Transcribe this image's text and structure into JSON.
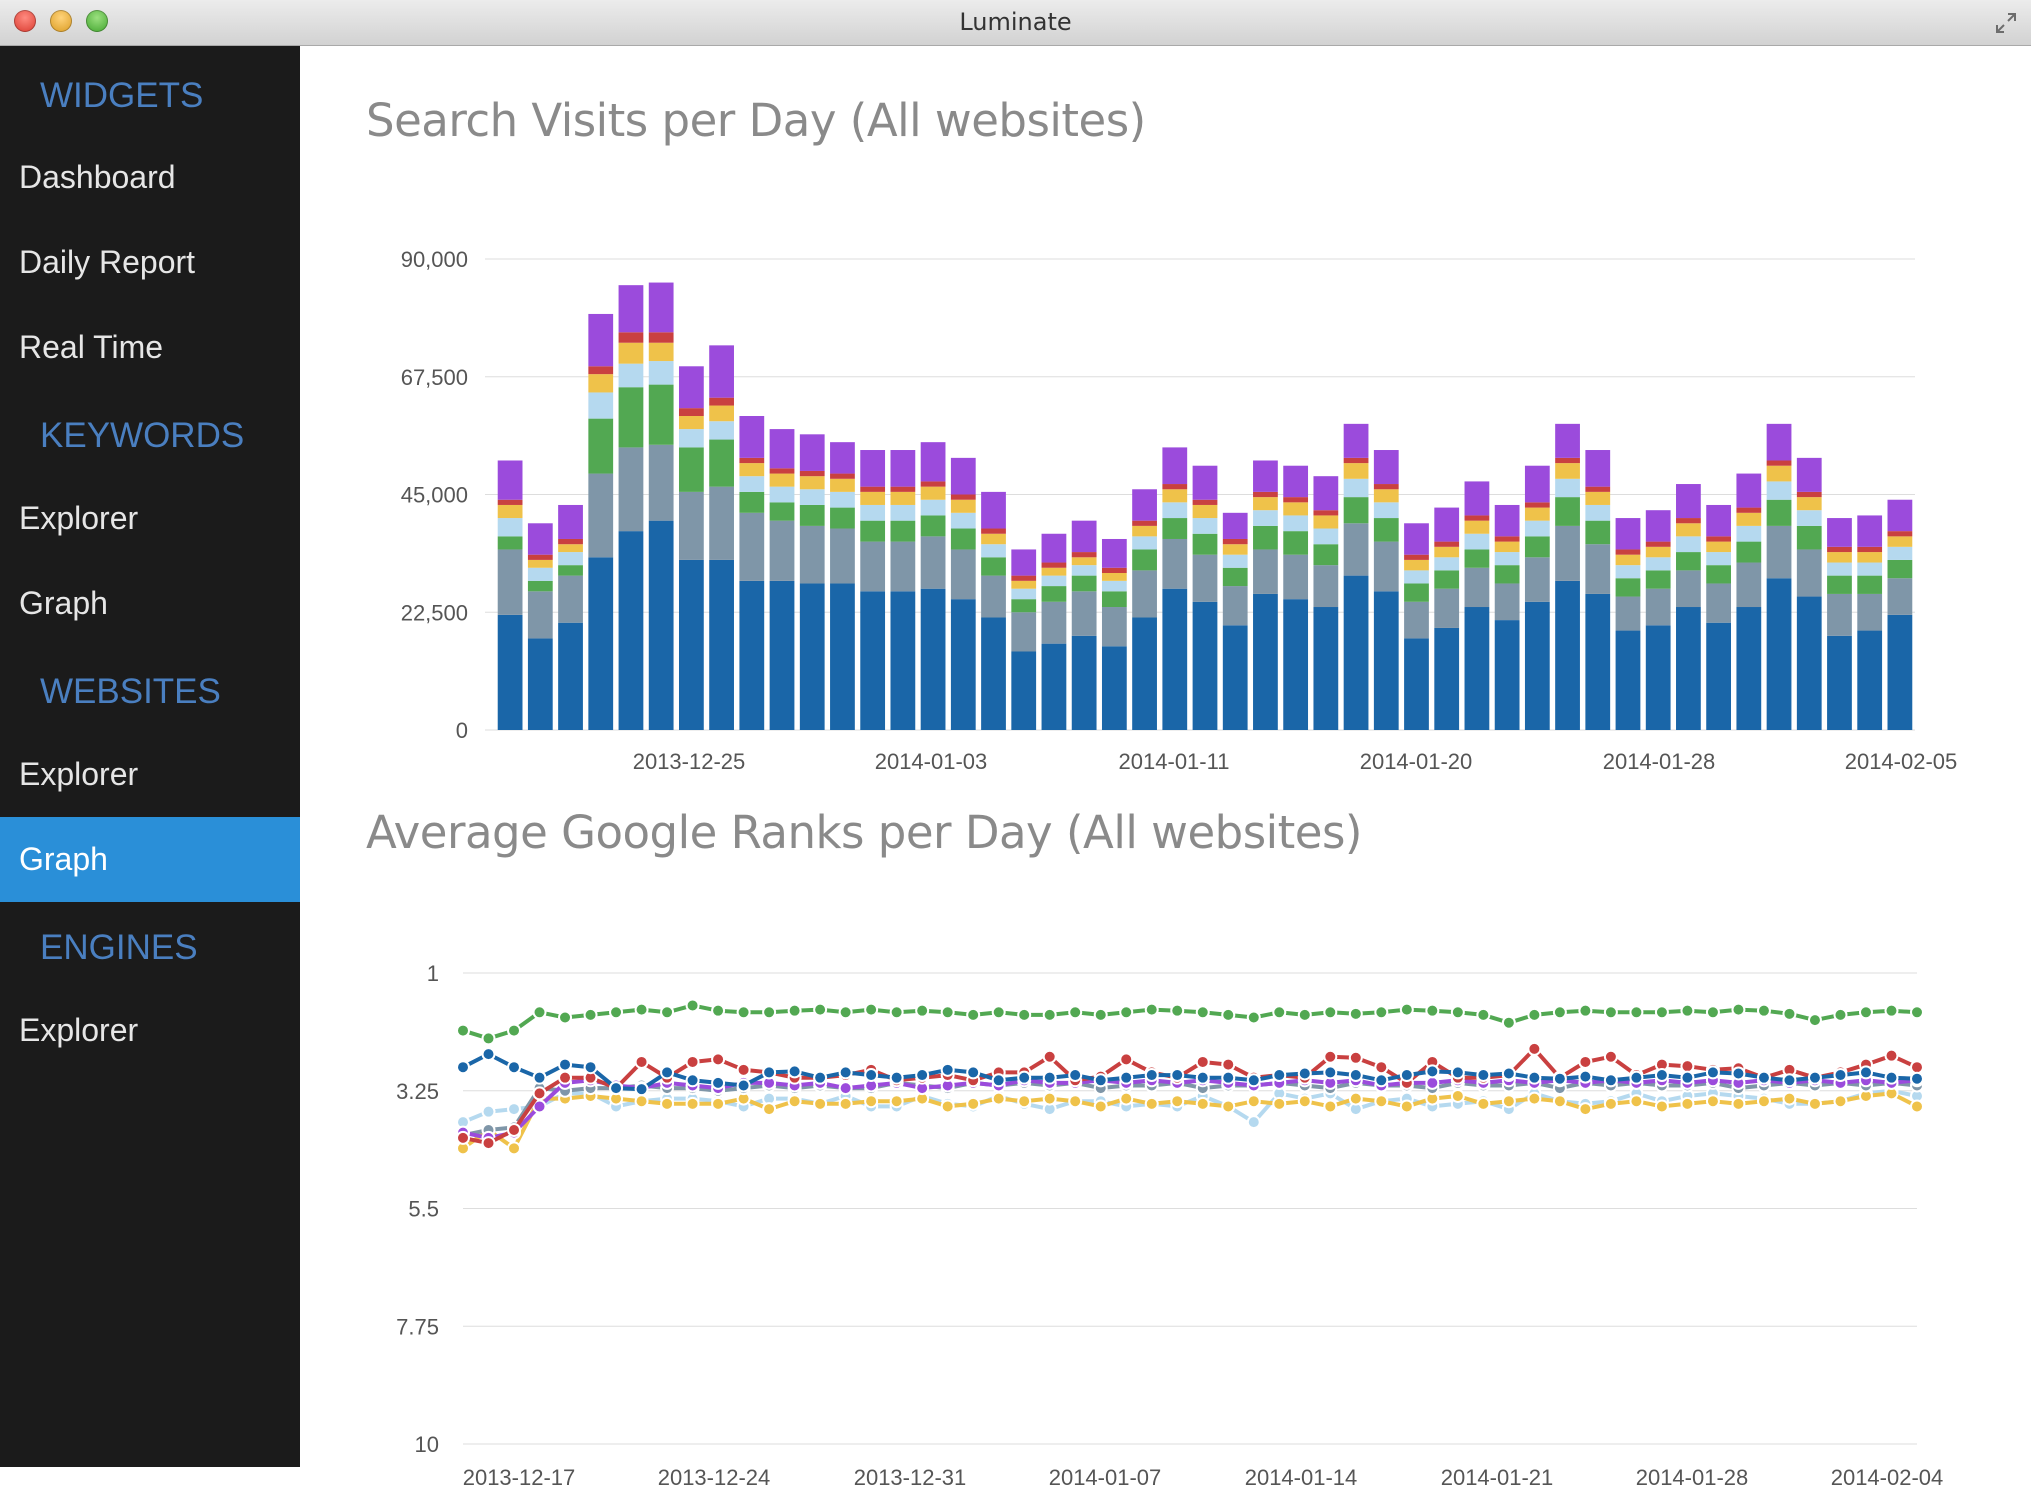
{
  "window": {
    "title": "Luminate"
  },
  "sidebar": {
    "groups": [
      {
        "label": "WIDGETS",
        "items": [
          {
            "label": "Dashboard"
          },
          {
            "label": "Daily Report"
          },
          {
            "label": "Real Time"
          }
        ]
      },
      {
        "label": "KEYWORDS",
        "items": [
          {
            "label": "Explorer"
          },
          {
            "label": "Graph"
          }
        ]
      },
      {
        "label": "WEBSITES",
        "items": [
          {
            "label": "Explorer"
          },
          {
            "label": "Graph",
            "active": true
          }
        ]
      },
      {
        "label": "ENGINES",
        "items": [
          {
            "label": "Explorer"
          }
        ]
      }
    ]
  },
  "main": {
    "visits_title": "Search Visits per Day (All websites)",
    "ranks_title": "Average Google Ranks per Day (All websites)"
  },
  "colors": {
    "sidebar_bg": "#1b1b1b",
    "group_label": "#4a7fc0",
    "active_item": "#2a8fd8",
    "series": [
      "#1a66a8",
      "#7f96a8",
      "#52a852",
      "#b5d9ef",
      "#efc24a",
      "#c94040",
      "#9b4bdc"
    ]
  },
  "chart_data": [
    {
      "type": "bar",
      "stacked": true,
      "title": "Search Visits per Day (All websites)",
      "ylim": [
        0,
        90000
      ],
      "yticks": [
        "90,000",
        "67,500",
        "45,000",
        "22,500",
        "0"
      ],
      "xtick_labels": [
        "2013-12-25",
        "2014-01-03",
        "2014-01-11",
        "2014-01-20",
        "2014-01-28",
        "2014-02-05"
      ],
      "grid": true,
      "series": [
        {
          "color": "#1a66a8",
          "values": [
            22000,
            17500,
            20500,
            33000,
            38000,
            40000,
            32500,
            32500,
            28500,
            28500,
            28000,
            28000,
            26500,
            26500,
            27000,
            25000,
            21500,
            15000,
            16500,
            18000,
            16000,
            21500,
            27000,
            24500,
            20000,
            26000,
            25000,
            23500,
            29500,
            26500,
            17500,
            19500,
            23500,
            21000,
            24500,
            28500,
            26000,
            19000,
            20000,
            23500,
            20500,
            23500,
            29000,
            25500,
            18000,
            19000,
            22000
          ]
        },
        {
          "color": "#7f96a8",
          "values": [
            12500,
            9000,
            9000,
            16000,
            16000,
            14500,
            13000,
            14000,
            13000,
            11500,
            11000,
            10500,
            9500,
            9500,
            10000,
            9500,
            8000,
            7500,
            8000,
            8500,
            7500,
            9000,
            9500,
            9000,
            7500,
            8500,
            8500,
            8000,
            10000,
            9500,
            7000,
            7500,
            7500,
            7000,
            8500,
            10500,
            9500,
            6500,
            7000,
            7000,
            7500,
            8500,
            10000,
            9000,
            8000,
            7000,
            7000
          ]
        },
        {
          "color": "#52a852",
          "values": [
            2500,
            2000,
            2000,
            10500,
            11500,
            11500,
            8500,
            9000,
            4000,
            3500,
            4000,
            4000,
            4000,
            4000,
            4000,
            4000,
            3500,
            2500,
            3000,
            3000,
            3000,
            4000,
            4000,
            4000,
            3500,
            4500,
            4500,
            4000,
            5000,
            4500,
            3500,
            3500,
            3500,
            3500,
            4000,
            5500,
            4500,
            3500,
            3500,
            3500,
            3500,
            4000,
            5000,
            4500,
            3500,
            3500,
            3500
          ]
        },
        {
          "color": "#b5d9ef",
          "values": [
            3500,
            2500,
            2500,
            5000,
            4500,
            4500,
            3500,
            3500,
            3000,
            3000,
            3000,
            3000,
            3000,
            3000,
            3000,
            3000,
            2500,
            2000,
            2000,
            2000,
            2000,
            2500,
            3000,
            3000,
            2500,
            3000,
            3000,
            3000,
            3500,
            3000,
            2500,
            2500,
            3000,
            2500,
            3000,
            3500,
            3000,
            2500,
            2500,
            3000,
            2500,
            3000,
            3500,
            3000,
            2500,
            2500,
            2500
          ]
        },
        {
          "color": "#efc24a",
          "values": [
            2500,
            1500,
            1500,
            3500,
            4000,
            3500,
            2500,
            3000,
            2500,
            2500,
            2500,
            2500,
            2500,
            2500,
            2500,
            2500,
            2000,
            1500,
            1500,
            1500,
            1500,
            2000,
            2500,
            2500,
            2000,
            2500,
            2500,
            2500,
            3000,
            2500,
            2000,
            2000,
            2500,
            2000,
            2500,
            3000,
            2500,
            2000,
            2000,
            2500,
            2000,
            2500,
            3000,
            2500,
            2000,
            2000,
            2000
          ]
        },
        {
          "color": "#c94040",
          "values": [
            1000,
            1000,
            1000,
            1500,
            2000,
            2000,
            1500,
            1500,
            1000,
            1000,
            1000,
            1000,
            1000,
            1000,
            1000,
            1000,
            1000,
            1000,
            1000,
            1000,
            1000,
            1000,
            1000,
            1000,
            1000,
            1000,
            1000,
            1000,
            1000,
            1000,
            1000,
            1000,
            1000,
            1000,
            1000,
            1000,
            1000,
            1000,
            1000,
            1000,
            1000,
            1000,
            1000,
            1000,
            1000,
            1000,
            1000
          ]
        },
        {
          "color": "#9b4bdc",
          "values": [
            7500,
            6000,
            6500,
            10000,
            9000,
            9500,
            8000,
            10000,
            8000,
            7500,
            7000,
            6000,
            7000,
            7000,
            7500,
            7000,
            7000,
            5000,
            5500,
            6000,
            5500,
            6000,
            7000,
            6500,
            5000,
            6000,
            6000,
            6500,
            6500,
            6500,
            6000,
            6500,
            6500,
            6000,
            7000,
            6500,
            7000,
            6000,
            6000,
            6500,
            6000,
            6500,
            7000,
            6500,
            5500,
            6000,
            6000
          ]
        }
      ]
    },
    {
      "type": "line",
      "title": "Average Google Ranks per Day (All websites)",
      "ylim": [
        1,
        10
      ],
      "y_inverted": true,
      "yticks": [
        "1",
        "3.25",
        "5.5",
        "7.75",
        "10"
      ],
      "xtick_labels": [
        "2013-12-17",
        "2013-12-24",
        "2013-12-31",
        "2014-01-07",
        "2014-01-14",
        "2014-01-21",
        "2014-01-28",
        "2014-02-04"
      ],
      "grid": true,
      "series": [
        {
          "color": "#52a852",
          "values": [
            2.1,
            2.25,
            2.1,
            1.75,
            1.85,
            1.8,
            1.75,
            1.7,
            1.75,
            1.62,
            1.72,
            1.75,
            1.75,
            1.72,
            1.7,
            1.75,
            1.7,
            1.75,
            1.72,
            1.75,
            1.8,
            1.75,
            1.8,
            1.8,
            1.75,
            1.8,
            1.75,
            1.7,
            1.72,
            1.75,
            1.8,
            1.85,
            1.75,
            1.8,
            1.75,
            1.78,
            1.75,
            1.7,
            1.72,
            1.75,
            1.8,
            1.95,
            1.8,
            1.75,
            1.72,
            1.75,
            1.75,
            1.75,
            1.72,
            1.75,
            1.7,
            1.72,
            1.78,
            1.9,
            1.8,
            1.75,
            1.72,
            1.75
          ]
        },
        {
          "color": "#1a66a8",
          "values": [
            2.8,
            2.55,
            2.8,
            3.0,
            2.75,
            2.8,
            3.2,
            3.22,
            2.9,
            3.05,
            3.1,
            3.15,
            2.9,
            2.88,
            3.0,
            2.9,
            2.95,
            3.0,
            2.95,
            2.85,
            2.9,
            3.05,
            3.0,
            3.0,
            2.95,
            3.05,
            3.0,
            2.95,
            2.95,
            3.0,
            3.0,
            3.05,
            2.95,
            2.92,
            2.9,
            2.95,
            3.05,
            2.95,
            2.88,
            2.9,
            2.95,
            2.92,
            3.0,
            3.02,
            2.98,
            3.05,
            3.0,
            2.95,
            3.0,
            2.9,
            2.92,
            3.0,
            3.05,
            3.0,
            2.95,
            2.9,
            3.0,
            3.02
          ]
        },
        {
          "color": "#c94040",
          "values": [
            4.15,
            4.25,
            4.0,
            3.3,
            3.0,
            3.0,
            3.2,
            2.7,
            3.0,
            2.7,
            2.65,
            2.85,
            2.9,
            3.0,
            3.0,
            2.95,
            2.85,
            3.05,
            3.0,
            2.95,
            3.05,
            2.9,
            2.9,
            2.6,
            3.05,
            2.98,
            2.65,
            2.9,
            3.0,
            2.7,
            2.75,
            3.0,
            2.95,
            3.0,
            2.6,
            2.62,
            2.8,
            3.1,
            2.7,
            3.0,
            3.0,
            2.95,
            2.45,
            3.0,
            2.7,
            2.6,
            2.95,
            2.75,
            2.78,
            2.85,
            2.82,
            3.0,
            2.85,
            3.0,
            2.9,
            2.75,
            2.58,
            2.8
          ]
        },
        {
          "color": "#9b4bdc",
          "values": [
            4.05,
            4.15,
            4.05,
            3.55,
            3.1,
            3.05,
            3.15,
            3.2,
            3.1,
            3.15,
            3.2,
            3.1,
            3.1,
            3.15,
            3.1,
            3.2,
            3.15,
            3.1,
            3.2,
            3.15,
            3.1,
            3.15,
            3.05,
            3.1,
            3.1,
            3.05,
            3.1,
            3.05,
            3.1,
            3.05,
            3.1,
            3.15,
            3.1,
            3.05,
            3.1,
            3.05,
            3.15,
            3.1,
            3.1,
            3.05,
            3.1,
            3.05,
            3.1,
            3.05,
            3.1,
            3.05,
            3.1,
            3.05,
            3.1,
            3.05,
            3.1,
            3.05,
            3.1,
            3.05,
            3.1,
            3.05,
            3.1,
            3.05
          ]
        },
        {
          "color": "#7f96a8",
          "values": [
            4.1,
            4.0,
            3.95,
            3.2,
            3.25,
            3.2,
            3.2,
            3.15,
            3.2,
            3.2,
            3.25,
            3.2,
            3.15,
            3.2,
            3.15,
            3.2,
            3.2,
            3.1,
            3.15,
            3.2,
            3.1,
            3.15,
            3.1,
            3.15,
            3.1,
            3.2,
            3.15,
            3.15,
            3.1,
            3.2,
            3.15,
            3.15,
            3.1,
            3.15,
            3.2,
            3.1,
            3.15,
            3.15,
            3.2,
            3.1,
            3.15,
            3.15,
            3.1,
            3.2,
            3.1,
            3.15,
            3.1,
            3.15,
            3.15,
            3.1,
            3.2,
            3.15,
            3.1,
            3.15,
            3.1,
            3.15,
            3.1,
            3.15
          ]
        },
        {
          "color": "#efc24a",
          "values": [
            4.35,
            4.0,
            4.35,
            3.4,
            3.4,
            3.35,
            3.4,
            3.45,
            3.5,
            3.5,
            3.5,
            3.4,
            3.6,
            3.45,
            3.5,
            3.5,
            3.45,
            3.45,
            3.4,
            3.55,
            3.5,
            3.4,
            3.45,
            3.4,
            3.45,
            3.55,
            3.4,
            3.5,
            3.45,
            3.5,
            3.55,
            3.45,
            3.5,
            3.45,
            3.55,
            3.4,
            3.45,
            3.55,
            3.4,
            3.35,
            3.5,
            3.45,
            3.4,
            3.45,
            3.6,
            3.5,
            3.45,
            3.55,
            3.5,
            3.45,
            3.5,
            3.45,
            3.4,
            3.5,
            3.45,
            3.35,
            3.3,
            3.55
          ]
        },
        {
          "color": "#b5d9ef",
          "values": [
            3.85,
            3.65,
            3.6,
            3.55,
            3.3,
            3.3,
            3.55,
            3.45,
            3.4,
            3.4,
            3.45,
            3.55,
            3.4,
            3.4,
            3.5,
            3.35,
            3.55,
            3.55,
            3.35,
            3.5,
            3.55,
            3.35,
            3.5,
            3.6,
            3.45,
            3.45,
            3.55,
            3.5,
            3.55,
            3.35,
            3.55,
            3.85,
            3.3,
            3.4,
            3.3,
            3.6,
            3.45,
            3.4,
            3.55,
            3.5,
            3.45,
            3.6,
            3.3,
            3.45,
            3.5,
            3.45,
            3.3,
            3.45,
            3.35,
            3.3,
            3.35,
            3.4,
            3.5,
            3.5,
            3.45,
            3.3,
            3.25,
            3.35
          ]
        }
      ]
    }
  ]
}
